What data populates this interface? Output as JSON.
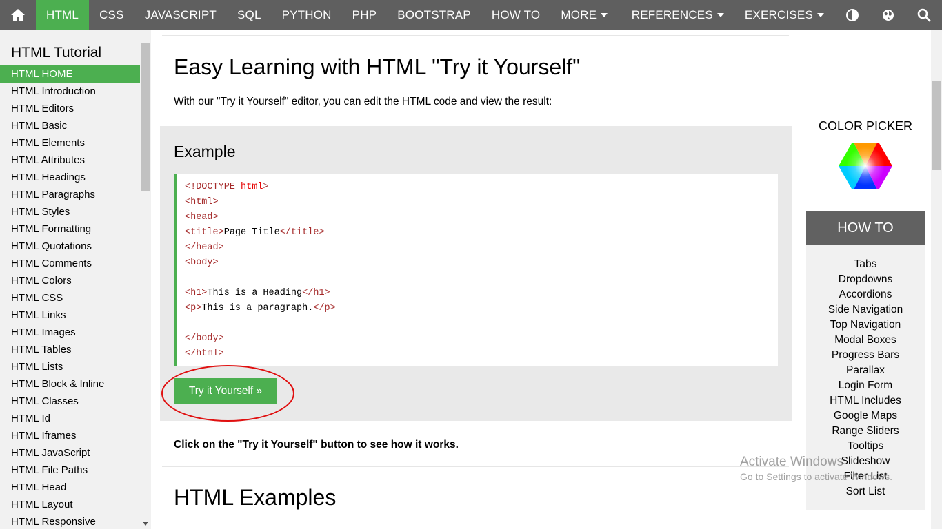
{
  "topnav": {
    "items": [
      "HTML",
      "CSS",
      "JAVASCRIPT",
      "SQL",
      "PYTHON",
      "PHP",
      "BOOTSTRAP",
      "HOW TO",
      "MORE"
    ],
    "right_items": [
      "REFERENCES",
      "EXERCISES"
    ],
    "colors": {
      "bar": "#5f5f5f",
      "active": "#4caf50"
    },
    "icons": [
      "home-icon",
      "contrast-icon",
      "globe-icon",
      "search-icon"
    ]
  },
  "sidebar": {
    "title": "HTML Tutorial",
    "items": [
      "HTML HOME",
      "HTML Introduction",
      "HTML Editors",
      "HTML Basic",
      "HTML Elements",
      "HTML Attributes",
      "HTML Headings",
      "HTML Paragraphs",
      "HTML Styles",
      "HTML Formatting",
      "HTML Quotations",
      "HTML Comments",
      "HTML Colors",
      "HTML CSS",
      "HTML Links",
      "HTML Images",
      "HTML Tables",
      "HTML Lists",
      "HTML Block & Inline",
      "HTML Classes",
      "HTML Id",
      "HTML Iframes",
      "HTML JavaScript",
      "HTML File Paths",
      "HTML Head",
      "HTML Layout",
      "HTML Responsive"
    ],
    "active_item": "HTML HOME"
  },
  "main": {
    "title": "Easy Learning with HTML \"Try it Yourself\"",
    "intro": "With our \"Try it Yourself\" editor, you can edit the HTML code and view the result:",
    "example_heading": "Example",
    "code": {
      "doctype_open": "<!DOCTYPE",
      "doctype_attr": " html",
      "doctype_close": ">",
      "html_open": "<html>",
      "head_open": "<head>",
      "title_open": "<title>",
      "title_text": "Page Title",
      "title_close": "</title>",
      "head_close": "</head>",
      "body_open": "<body>",
      "h1_open": "<h1>",
      "h1_text": "This is a Heading",
      "h1_close": "</h1>",
      "p_open": "<p>",
      "p_text": "This is a paragraph.",
      "p_close": "</p>",
      "body_close": "</body>",
      "html_close": "</html>"
    },
    "try_button": "Try it Yourself »",
    "click_note": "Click on the \"Try it Yourself\" button to see how it works.",
    "examples_heading": "HTML Examples"
  },
  "right": {
    "color_picker_label": "COLOR PICKER",
    "howto_heading": "HOW TO",
    "howto_items": [
      "Tabs",
      "Dropdowns",
      "Accordions",
      "Side Navigation",
      "Top Navigation",
      "Modal Boxes",
      "Progress Bars",
      "Parallax",
      "Login Form",
      "HTML Includes",
      "Google Maps",
      "Range Sliders",
      "Tooltips",
      "Slideshow",
      "Filter List",
      "Sort List"
    ]
  },
  "watermark": {
    "line1": "Activate Windows",
    "line2": "Go to Settings to activate Windows."
  }
}
